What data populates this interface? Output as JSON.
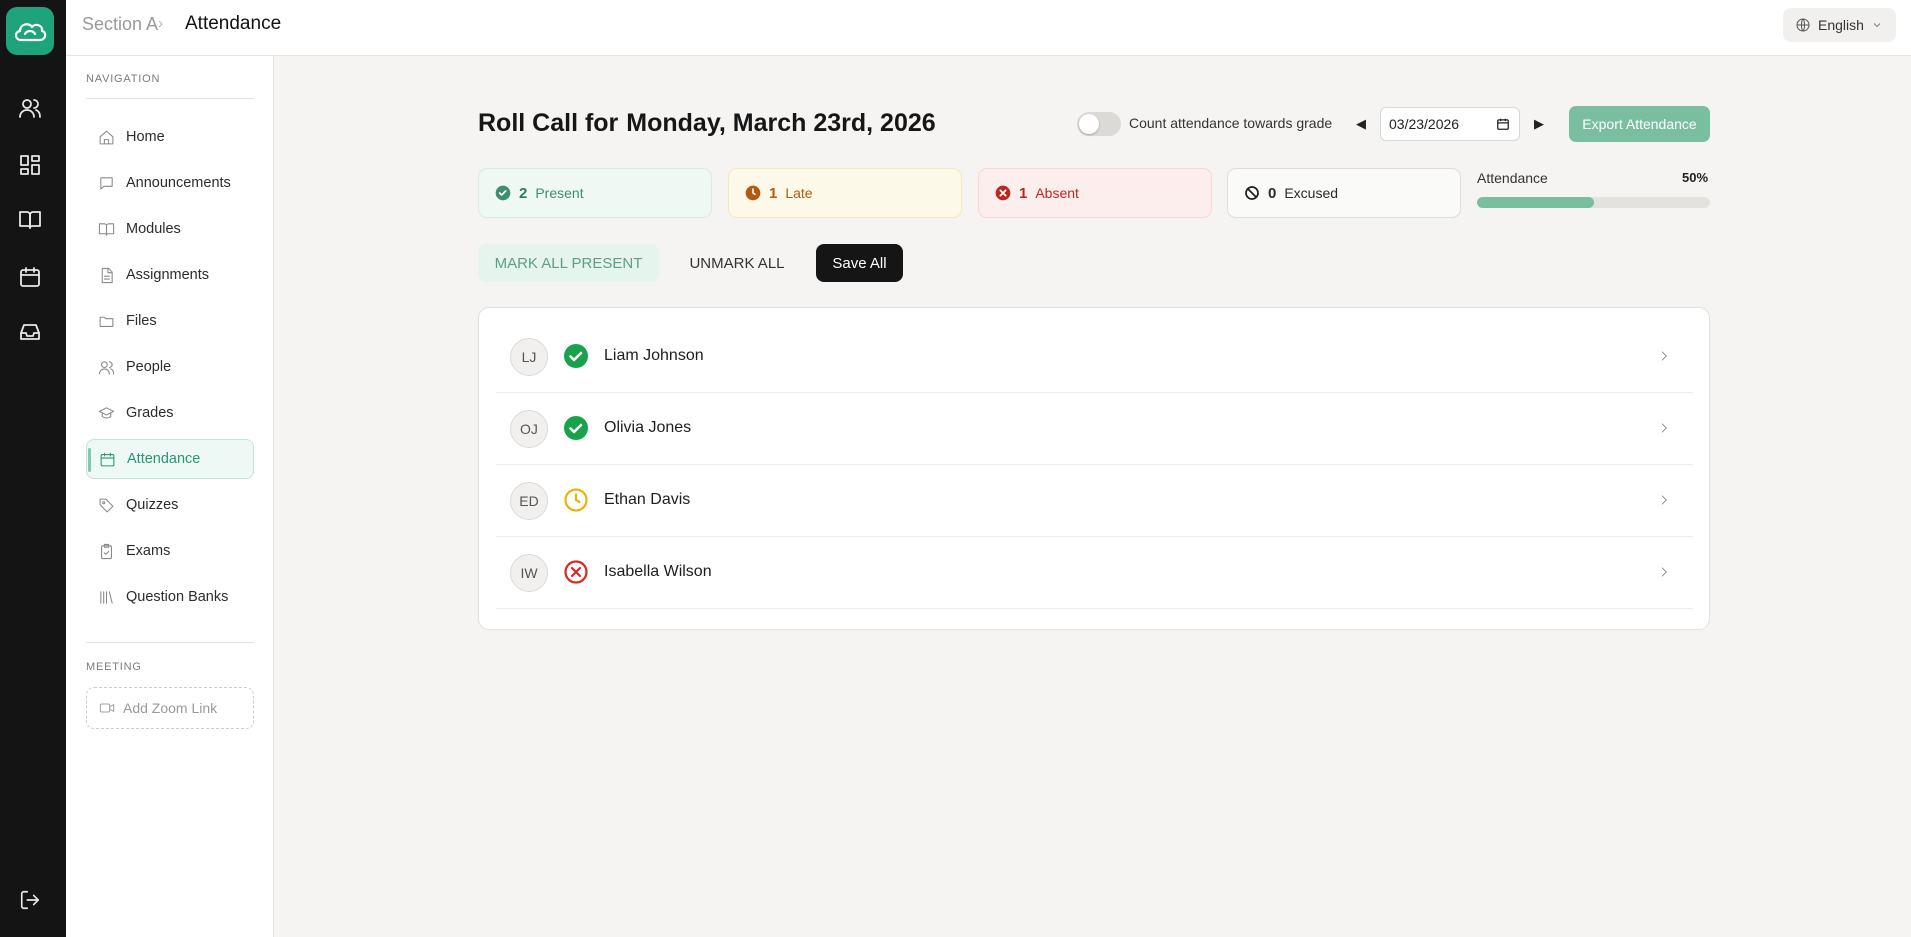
{
  "breadcrumb": {
    "parent": "Section A",
    "separator": "›",
    "current": "Attendance"
  },
  "language": {
    "label": "English",
    "icon": "globe-icon"
  },
  "rail": {
    "logo_icon": "cloud-logo-icon",
    "items": [
      {
        "icon": "users-icon"
      },
      {
        "icon": "dashboard-icon"
      },
      {
        "icon": "book-icon"
      },
      {
        "icon": "calendar-icon"
      },
      {
        "icon": "inbox-icon"
      }
    ],
    "logout_icon": "logout-icon"
  },
  "sidebar": {
    "nav_title": "NAVIGATION",
    "items": [
      {
        "label": "Home",
        "icon": "home-icon"
      },
      {
        "label": "Announcements",
        "icon": "message-icon"
      },
      {
        "label": "Modules",
        "icon": "book-open-icon"
      },
      {
        "label": "Assignments",
        "icon": "file-text-icon"
      },
      {
        "label": "Files",
        "icon": "folder-icon"
      },
      {
        "label": "People",
        "icon": "users-icon"
      },
      {
        "label": "Grades",
        "icon": "graduation-cap-icon"
      },
      {
        "label": "Attendance",
        "icon": "calendar-icon",
        "active": true
      },
      {
        "label": "Quizzes",
        "icon": "tag-icon"
      },
      {
        "label": "Exams",
        "icon": "clipboard-check-icon"
      },
      {
        "label": "Question Banks",
        "icon": "library-icon"
      }
    ],
    "meeting_title": "MEETING",
    "zoom_label": "Add Zoom Link"
  },
  "main": {
    "title_prefix": "Roll Call for",
    "title_date": "Monday, March 23rd, 2026",
    "toggle_label": "Count attendance towards grade",
    "toggle_on": false,
    "prev_arrow": "◀",
    "next_arrow": "▶",
    "date_value": "03/23/2026",
    "export_label": "Export Attendance",
    "stats": {
      "present": {
        "count": "2",
        "label": "Present"
      },
      "late": {
        "count": "1",
        "label": "Late"
      },
      "absent": {
        "count": "1",
        "label": "Absent"
      },
      "excused": {
        "count": "0",
        "label": "Excused"
      }
    },
    "attendance": {
      "label": "Attendance",
      "percent_text": "50%",
      "fraction": 0.5
    },
    "buttons": {
      "mark_all": "MARK ALL PRESENT",
      "unmark_all": "UNMARK ALL",
      "save_all": "Save All"
    },
    "students": [
      {
        "initials": "LJ",
        "name": "Liam Johnson",
        "status": "present"
      },
      {
        "initials": "OJ",
        "name": "Olivia Jones",
        "status": "present"
      },
      {
        "initials": "ED",
        "name": "Ethan Davis",
        "status": "late"
      },
      {
        "initials": "IW",
        "name": "Isabella Wilson",
        "status": "absent"
      }
    ]
  },
  "colors": {
    "accent": "#1ea37c",
    "present": "#16a34a",
    "late": "#eab308",
    "absent": "#dc2626"
  }
}
